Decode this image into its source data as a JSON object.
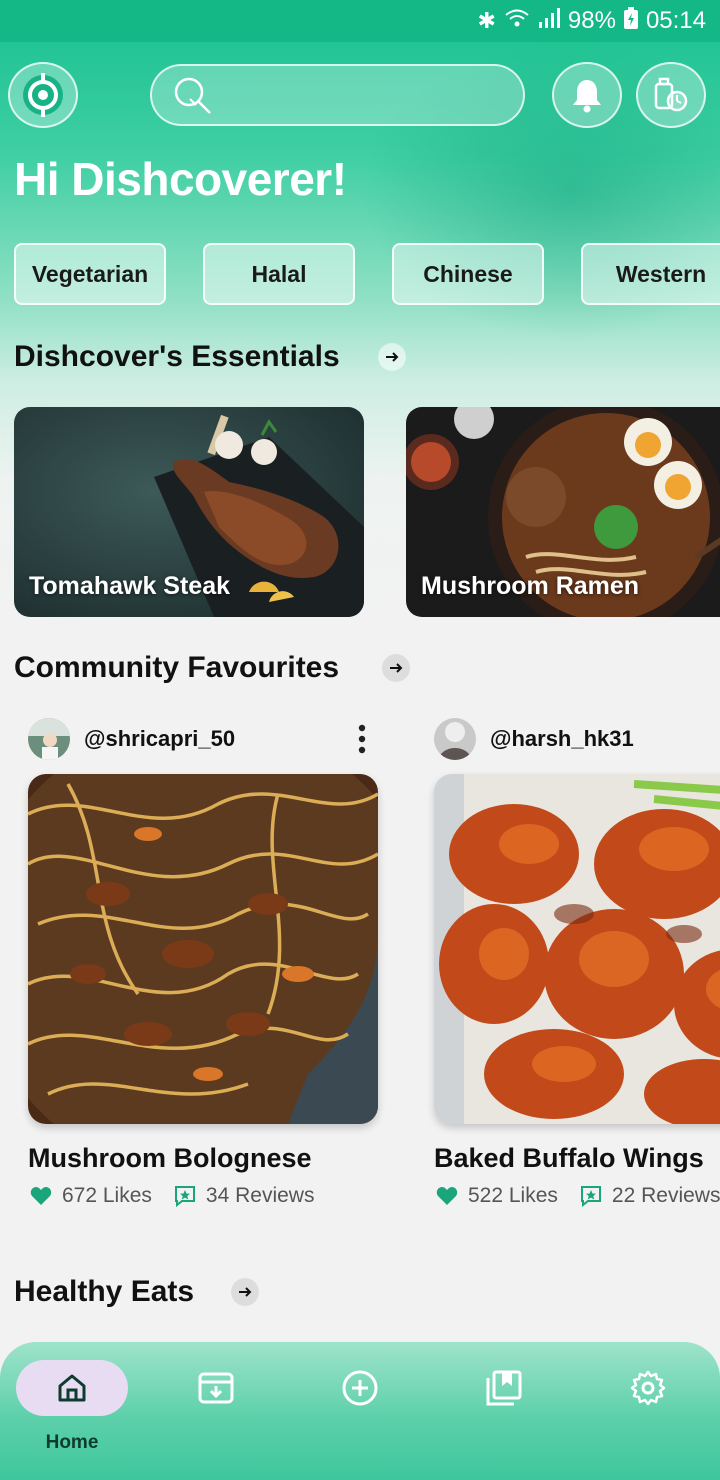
{
  "status_bar": {
    "battery": "98%",
    "time": "05:14"
  },
  "search": {
    "placeholder": ""
  },
  "greeting": "Hi Dishcoverer!",
  "categories": [
    "Vegetarian",
    "Halal",
    "Chinese",
    "Western"
  ],
  "essentials": {
    "title": "Dishcover's Essentials",
    "items": [
      {
        "label": "Tomahawk Steak"
      },
      {
        "label": "Mushroom Ramen"
      }
    ]
  },
  "community": {
    "title": "Community Favourites",
    "posts": [
      {
        "username": "@shricapri_50",
        "title": "Mushroom Bolognese",
        "likes": "672 Likes",
        "reviews": "34 Reviews"
      },
      {
        "username": "@harsh_hk31",
        "title": "Baked Buffalo Wings",
        "likes": "522 Likes",
        "reviews": "22 Reviews"
      }
    ]
  },
  "healthy": {
    "title": "Healthy Eats"
  },
  "nav": {
    "active": "Home",
    "items": [
      {
        "icon": "home-icon",
        "label": "Home"
      },
      {
        "icon": "tray-icon"
      },
      {
        "icon": "add-circle-icon"
      },
      {
        "icon": "bookmarks-icon"
      },
      {
        "icon": "settings-icon"
      }
    ]
  },
  "colors": {
    "brand": "#17c08f",
    "nav_active_pill": "#e8dcf3",
    "like_heart": "#1aa57a"
  }
}
